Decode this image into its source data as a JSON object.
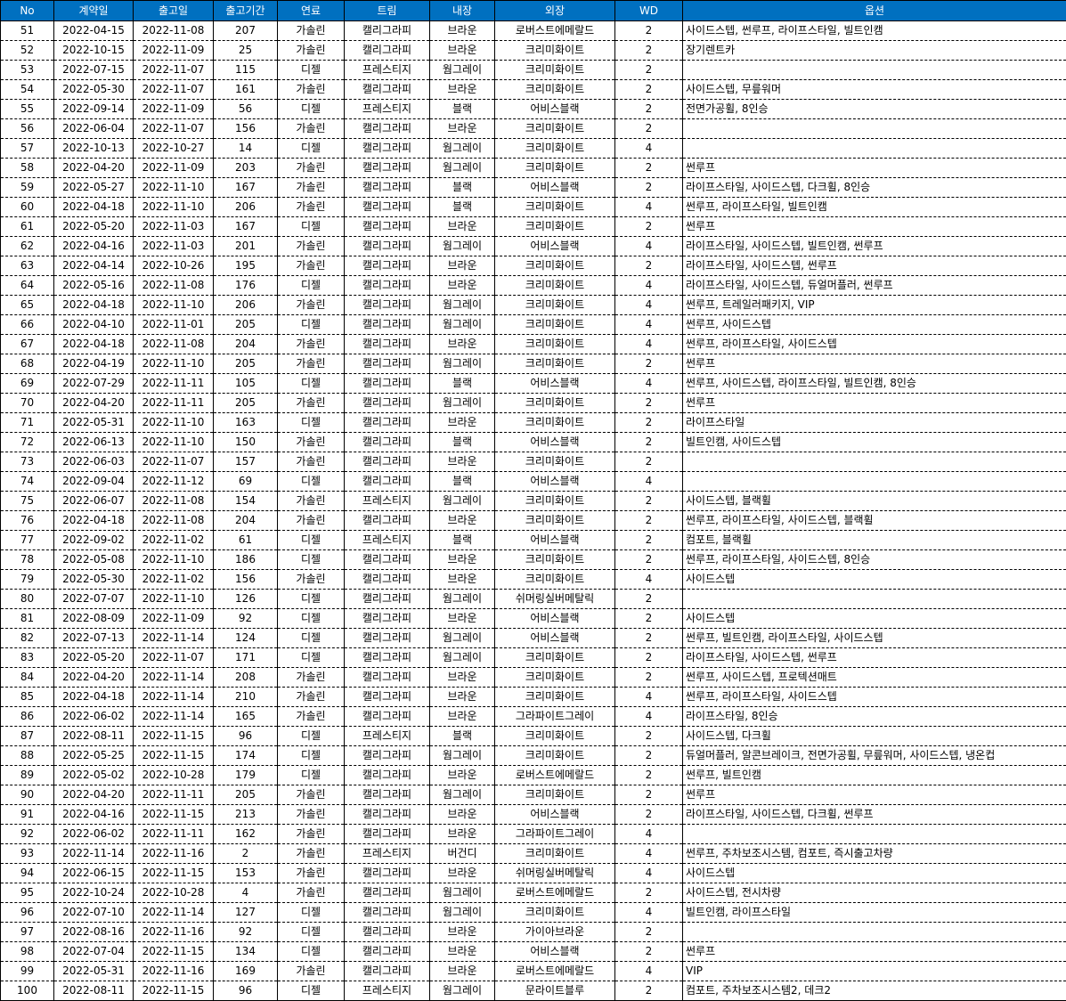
{
  "headers": [
    "No",
    "계약일",
    "출고일",
    "출고기간",
    "연료",
    "트림",
    "내장",
    "외장",
    "WD",
    "옵션"
  ],
  "rows": [
    [
      "51",
      "2022-04-15",
      "2022-11-08",
      "207",
      "가솔린",
      "캘리그라피",
      "브라운",
      "로버스트에메랄드",
      "2",
      "사이드스텝, 썬루프, 라이프스타일, 빌트인캠"
    ],
    [
      "52",
      "2022-10-15",
      "2022-11-09",
      "25",
      "가솔린",
      "캘리그라피",
      "브라운",
      "크리미화이트",
      "2",
      "장기렌트카"
    ],
    [
      "53",
      "2022-07-15",
      "2022-11-07",
      "115",
      "디젤",
      "프레스티지",
      "웜그레이",
      "크리미화이트",
      "2",
      ""
    ],
    [
      "54",
      "2022-05-30",
      "2022-11-07",
      "161",
      "가솔린",
      "캘리그라피",
      "브라운",
      "크리미화이트",
      "2",
      "사이드스텝, 무릎워머"
    ],
    [
      "55",
      "2022-09-14",
      "2022-11-09",
      "56",
      "디젤",
      "프레스티지",
      "블랙",
      "어비스블랙",
      "2",
      "전면가공휠, 8인승"
    ],
    [
      "56",
      "2022-06-04",
      "2022-11-07",
      "156",
      "가솔린",
      "캘리그라피",
      "브라운",
      "크리미화이트",
      "2",
      ""
    ],
    [
      "57",
      "2022-10-13",
      "2022-10-27",
      "14",
      "디젤",
      "캘리그라피",
      "웜그레이",
      "크리미화이트",
      "4",
      ""
    ],
    [
      "58",
      "2022-04-20",
      "2022-11-09",
      "203",
      "가솔린",
      "캘리그라피",
      "웜그레이",
      "크리미화이트",
      "2",
      "썬루프"
    ],
    [
      "59",
      "2022-05-27",
      "2022-11-10",
      "167",
      "가솔린",
      "캘리그라피",
      "블랙",
      "어비스블랙",
      "2",
      "라이프스타일, 사이드스텝, 다크휠, 8인승"
    ],
    [
      "60",
      "2022-04-18",
      "2022-11-10",
      "206",
      "가솔린",
      "캘리그라피",
      "블랙",
      "크리미화이트",
      "4",
      "썬루프, 라이프스타일, 빌트인캠"
    ],
    [
      "61",
      "2022-05-20",
      "2022-11-03",
      "167",
      "디젤",
      "캘리그라피",
      "브라운",
      "크리미화이트",
      "2",
      "썬루프"
    ],
    [
      "62",
      "2022-04-16",
      "2022-11-03",
      "201",
      "가솔린",
      "캘리그라피",
      "웜그레이",
      "어비스블랙",
      "4",
      "라이프스타일, 사이드스텝, 빌트인캠, 썬루프"
    ],
    [
      "63",
      "2022-04-14",
      "2022-10-26",
      "195",
      "가솔린",
      "캘리그라피",
      "브라운",
      "크리미화이트",
      "2",
      "라이프스타일, 사이드스텝, 썬루프"
    ],
    [
      "64",
      "2022-05-16",
      "2022-11-08",
      "176",
      "디젤",
      "캘리그라피",
      "브라운",
      "크리미화이트",
      "4",
      "라이프스타일, 사이드스텝, 듀얼머플러, 썬루프"
    ],
    [
      "65",
      "2022-04-18",
      "2022-11-10",
      "206",
      "가솔린",
      "캘리그라피",
      "웜그레이",
      "크리미화이트",
      "4",
      "썬루프, 트레일러패키지, VIP"
    ],
    [
      "66",
      "2022-04-10",
      "2022-11-01",
      "205",
      "디젤",
      "캘리그라피",
      "웜그레이",
      "크리미화이트",
      "4",
      "썬루프, 사이드스텝"
    ],
    [
      "67",
      "2022-04-18",
      "2022-11-08",
      "204",
      "가솔린",
      "캘리그라피",
      "브라운",
      "크리미화이트",
      "4",
      "썬루프, 라이프스타일, 사이드스텝"
    ],
    [
      "68",
      "2022-04-19",
      "2022-11-10",
      "205",
      "가솔린",
      "캘리그라피",
      "웜그레이",
      "크리미화이트",
      "2",
      "썬루프"
    ],
    [
      "69",
      "2022-07-29",
      "2022-11-11",
      "105",
      "디젤",
      "캘리그라피",
      "블랙",
      "어비스블랙",
      "4",
      "썬루프, 사이드스텝, 라이프스타일, 빌트인캠, 8인승"
    ],
    [
      "70",
      "2022-04-20",
      "2022-11-11",
      "205",
      "가솔린",
      "캘리그라피",
      "웜그레이",
      "크리미화이트",
      "2",
      "썬루프"
    ],
    [
      "71",
      "2022-05-31",
      "2022-11-10",
      "163",
      "디젤",
      "캘리그라피",
      "브라운",
      "크리미화이트",
      "2",
      "라이프스타일"
    ],
    [
      "72",
      "2022-06-13",
      "2022-11-10",
      "150",
      "가솔린",
      "캘리그라피",
      "블랙",
      "어비스블랙",
      "2",
      "빌트인캠, 사이드스텝"
    ],
    [
      "73",
      "2022-06-03",
      "2022-11-07",
      "157",
      "가솔린",
      "캘리그라피",
      "브라운",
      "크리미화이트",
      "2",
      ""
    ],
    [
      "74",
      "2022-09-04",
      "2022-11-12",
      "69",
      "디젤",
      "캘리그라피",
      "블랙",
      "어비스블랙",
      "4",
      ""
    ],
    [
      "75",
      "2022-06-07",
      "2022-11-08",
      "154",
      "가솔린",
      "프레스티지",
      "웜그레이",
      "크리미화이트",
      "2",
      "사이드스텝, 블랙휠"
    ],
    [
      "76",
      "2022-04-18",
      "2022-11-08",
      "204",
      "가솔린",
      "캘리그라피",
      "브라운",
      "크리미화이트",
      "2",
      "썬루프, 라이프스타일, 사이드스텝, 블랙휠"
    ],
    [
      "77",
      "2022-09-02",
      "2022-11-02",
      "61",
      "디젤",
      "프레스티지",
      "블랙",
      "어비스블랙",
      "2",
      "컴포트, 블랙휠"
    ],
    [
      "78",
      "2022-05-08",
      "2022-11-10",
      "186",
      "디젤",
      "캘리그라피",
      "브라운",
      "크리미화이트",
      "2",
      "썬루프, 라이프스타일, 사이드스텝, 8인승"
    ],
    [
      "79",
      "2022-05-30",
      "2022-11-02",
      "156",
      "가솔린",
      "캘리그라피",
      "브라운",
      "크리미화이트",
      "4",
      "사이드스텝"
    ],
    [
      "80",
      "2022-07-07",
      "2022-11-10",
      "126",
      "디젤",
      "캘리그라피",
      "웜그레이",
      "쉬머링실버메탈릭",
      "2",
      ""
    ],
    [
      "81",
      "2022-08-09",
      "2022-11-09",
      "92",
      "디젤",
      "캘리그라피",
      "브라운",
      "어비스블랙",
      "2",
      "사이드스텝"
    ],
    [
      "82",
      "2022-07-13",
      "2022-11-14",
      "124",
      "디젤",
      "캘리그라피",
      "웜그레이",
      "어비스블랙",
      "2",
      "썬루프, 빌트인캠, 라이프스타일, 사이드스텝"
    ],
    [
      "83",
      "2022-05-20",
      "2022-11-07",
      "171",
      "디젤",
      "캘리그라피",
      "웜그레이",
      "크리미화이트",
      "2",
      "라이프스타일, 사이드스텝, 썬루프"
    ],
    [
      "84",
      "2022-04-20",
      "2022-11-14",
      "208",
      "가솔린",
      "캘리그라피",
      "브라운",
      "크리미화이트",
      "2",
      "썬루프, 사이드스텝, 프로텍션매트"
    ],
    [
      "85",
      "2022-04-18",
      "2022-11-14",
      "210",
      "가솔린",
      "캘리그라피",
      "브라운",
      "크리미화이트",
      "4",
      "썬루프, 라이프스타일, 사이드스텝"
    ],
    [
      "86",
      "2022-06-02",
      "2022-11-14",
      "165",
      "가솔린",
      "캘리그라피",
      "브라운",
      "그라파이트그레이",
      "4",
      "라이프스타일, 8인승"
    ],
    [
      "87",
      "2022-08-11",
      "2022-11-15",
      "96",
      "디젤",
      "프레스티지",
      "블랙",
      "크리미화이트",
      "2",
      "사이드스텝, 다크휠"
    ],
    [
      "88",
      "2022-05-25",
      "2022-11-15",
      "174",
      "디젤",
      "캘리그라피",
      "웜그레이",
      "크리미화이트",
      "2",
      "듀얼머플러, 알콘브레이크, 전면가공휠, 무릎워머, 사이드스텝, 냉온컵"
    ],
    [
      "89",
      "2022-05-02",
      "2022-10-28",
      "179",
      "디젤",
      "캘리그라피",
      "브라운",
      "로버스트에메랄드",
      "2",
      "썬루프, 빌트인캠"
    ],
    [
      "90",
      "2022-04-20",
      "2022-11-11",
      "205",
      "가솔린",
      "캘리그라피",
      "웜그레이",
      "크리미화이트",
      "2",
      "썬루프"
    ],
    [
      "91",
      "2022-04-16",
      "2022-11-15",
      "213",
      "가솔린",
      "캘리그라피",
      "브라운",
      "어비스블랙",
      "2",
      "라이프스타일, 사이드스텝, 다크휠, 썬루프"
    ],
    [
      "92",
      "2022-06-02",
      "2022-11-11",
      "162",
      "가솔린",
      "캘리그라피",
      "브라운",
      "그라파이트그레이",
      "4",
      ""
    ],
    [
      "93",
      "2022-11-14",
      "2022-11-16",
      "2",
      "가솔린",
      "프레스티지",
      "버건디",
      "크리미화이트",
      "4",
      "썬루프, 주차보조시스템, 컴포트, 즉시출고차량"
    ],
    [
      "94",
      "2022-06-15",
      "2022-11-15",
      "153",
      "가솔린",
      "캘리그라피",
      "브라운",
      "쉬머링실버메탈릭",
      "4",
      "사이드스텝"
    ],
    [
      "95",
      "2022-10-24",
      "2022-10-28",
      "4",
      "가솔린",
      "캘리그라피",
      "웜그레이",
      "로버스트에메랄드",
      "2",
      "사이드스텝, 전시차량"
    ],
    [
      "96",
      "2022-07-10",
      "2022-11-14",
      "127",
      "디젤",
      "캘리그라피",
      "웜그레이",
      "크리미화이트",
      "4",
      "빌트인캠, 라이프스타일"
    ],
    [
      "97",
      "2022-08-16",
      "2022-11-16",
      "92",
      "디젤",
      "캘리그라피",
      "브라운",
      "가이아브라운",
      "2",
      ""
    ],
    [
      "98",
      "2022-07-04",
      "2022-11-15",
      "134",
      "디젤",
      "캘리그라피",
      "브라운",
      "어비스블랙",
      "2",
      "썬루프"
    ],
    [
      "99",
      "2022-05-31",
      "2022-11-16",
      "169",
      "가솔린",
      "캘리그라피",
      "브라운",
      "로버스트에메랄드",
      "4",
      "VIP"
    ],
    [
      "100",
      "2022-08-11",
      "2022-11-15",
      "96",
      "디젤",
      "프레스티지",
      "웜그레이",
      "문라이트블루",
      "2",
      "컴포트, 주차보조시스템2, 데크2"
    ]
  ]
}
